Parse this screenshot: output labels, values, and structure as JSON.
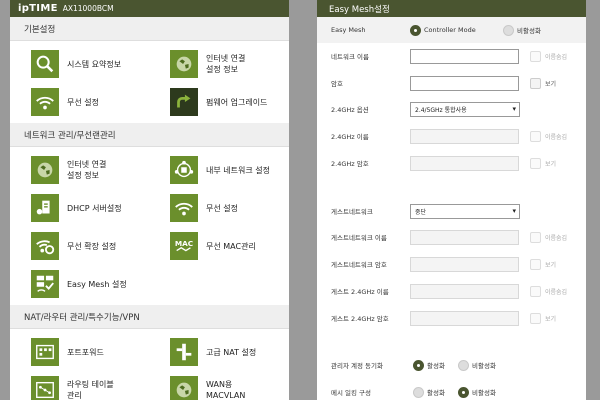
{
  "left": {
    "brand": "ipTIME",
    "model": "AX11000BCM",
    "sections": [
      {
        "title": "기본설정",
        "items": [
          {
            "label": "시스템 요약정보",
            "icon": "magnifier-icon"
          },
          {
            "label": "인터넷 연결\n설정 정보",
            "icon": "globe-icon"
          },
          {
            "label": "무선 설정",
            "icon": "wifi-icon"
          },
          {
            "label": "펌웨어 업그레이드",
            "icon": "upgrade-icon"
          }
        ]
      },
      {
        "title": "네트워크 관리/무선랜관리",
        "items": [
          {
            "label": "인터넷 연결\n설정 정보",
            "icon": "globe-icon"
          },
          {
            "label": "내부 네트워크 설정",
            "icon": "network-icon"
          },
          {
            "label": "DHCP 서버설정",
            "icon": "dhcp-server-icon"
          },
          {
            "label": "무선 설정",
            "icon": "wifi-icon"
          },
          {
            "label": "무선 확장 설정",
            "icon": "wifi-extend-icon"
          },
          {
            "label": "무선 MAC관리",
            "icon": "mac-icon"
          },
          {
            "label": "Easy Mesh 설정",
            "icon": "mesh-icon"
          }
        ]
      },
      {
        "title": "NAT/라우터 관리/특수기능/VPN",
        "items": [
          {
            "label": "포트포워드",
            "icon": "port-forward-icon"
          },
          {
            "label": "고급 NAT 설정",
            "icon": "advanced-nat-icon"
          },
          {
            "label": "라우팅 테이블\n관리",
            "icon": "routing-table-icon"
          },
          {
            "label": "WAN용\nMACVLAN",
            "icon": "macvlan-icon"
          }
        ]
      }
    ]
  },
  "right": {
    "title": "Easy Mesh설정",
    "easy_mesh": {
      "label": "Easy Mesh",
      "opt1": "Controller Mode",
      "opt2": "비활성화"
    },
    "network_name": {
      "label": "네트워크 이름",
      "checkbox": "이름숨김"
    },
    "password": {
      "label": "암호",
      "checkbox": "보기"
    },
    "band_option": {
      "label": "2.4GHz 옵션",
      "value": "2.4/5GHz 통합사용"
    },
    "name_24": {
      "label": "2.4GHz 이름",
      "checkbox": "이름숨김"
    },
    "pass_24": {
      "label": "2.4GHz 암호",
      "checkbox": "보기"
    },
    "guest_network": {
      "label": "게스트네트워크",
      "value": "중단"
    },
    "guest_name": {
      "label": "게스트네트워크 이름",
      "checkbox": "이름숨김"
    },
    "guest_pass": {
      "label": "게스트네트워크 암호",
      "checkbox": "보기"
    },
    "guest_name_24": {
      "label": "게스트 2.4GHz 이름",
      "checkbox": "이름숨김"
    },
    "guest_pass_24": {
      "label": "게스트 2.4GHz 암호",
      "checkbox": "보기"
    },
    "admin_sync": {
      "label": "관리자 계정 동기화",
      "opt1": "활성화",
      "opt2": "비활성화"
    },
    "mesh_build": {
      "label": "메시 일킹 구성",
      "opt1": "활성화",
      "opt2": "비활성화"
    }
  },
  "colors": {
    "accent": "#4a5530",
    "icon_green": "#6b8f2c",
    "icon_dark": "#2d3a1d"
  }
}
